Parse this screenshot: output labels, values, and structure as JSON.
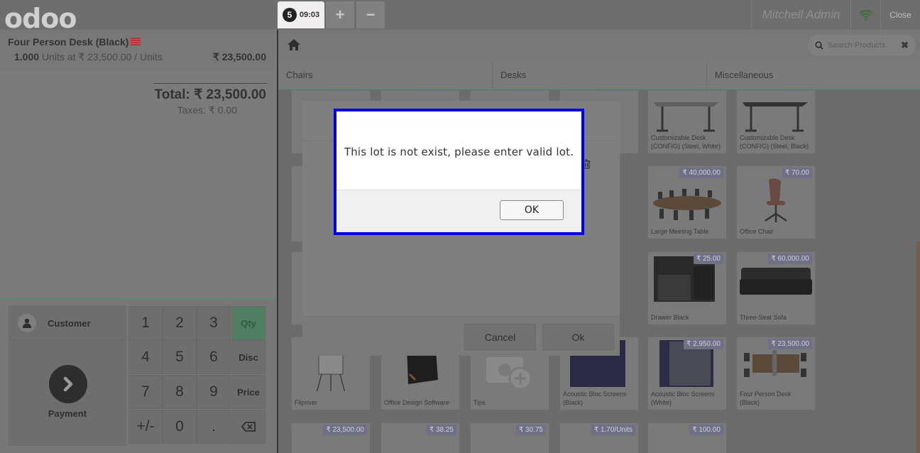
{
  "topbar": {
    "logo": "odoo",
    "order": {
      "number": "5",
      "time": "09:03"
    },
    "add_label": "+",
    "remove_label": "−",
    "user": "Mitchell Admin",
    "close_label": "Close"
  },
  "order": {
    "line": {
      "name": "Four Person Desk (Black)",
      "quantity": "1.000",
      "unit_text": "Units at ₹ 23,500.00 / Units",
      "price": "₹ 23,500.00"
    },
    "total": "Total: ₹ 23,500.00",
    "taxes": "Taxes: ₹ 0.00"
  },
  "actionpad": {
    "customer_label": "Customer",
    "payment_label": "Payment"
  },
  "numpad": {
    "keys": [
      "1",
      "2",
      "3",
      "4",
      "5",
      "6",
      "7",
      "8",
      "9",
      "+/-",
      "0",
      "."
    ],
    "modes": [
      "Qty",
      "Disc",
      "Price"
    ],
    "selected_mode": "Qty"
  },
  "products_header": {
    "search_placeholder": "Search Products",
    "categories": [
      "Chairs",
      "Desks",
      "Miscellaneous"
    ]
  },
  "products": [
    {
      "name": "Customizable Desk (CONFIG) (Steel, White)",
      "price": ""
    },
    {
      "name": "Customizable Desk (CONFIG) (Steel, Black)",
      "price": ""
    },
    {
      "name": "Large Meeting Table",
      "price": "₹ 40,000.00"
    },
    {
      "name": "Office Chair",
      "price": "₹ 70.00"
    },
    {
      "name": "Drawer Black",
      "price": "₹ 25.00"
    },
    {
      "name": "Three-Seat Sofa",
      "price": "₹ 60,000.00"
    },
    {
      "name": "Flipover",
      "price": ""
    },
    {
      "name": "Office Design Software",
      "price": ""
    },
    {
      "name": "Tips",
      "price": ""
    },
    {
      "name": "Acoustic Bloc Screens (Black)",
      "price": ""
    },
    {
      "name": "Acoustic Bloc Screens (White)",
      "price": "₹ 2,950.00"
    },
    {
      "name": "Four Person Desk (Black)",
      "price": "₹ 23,500.00"
    },
    {
      "name": "",
      "price": "₹ 23,500.00"
    },
    {
      "name": "",
      "price": "₹ 38.25"
    },
    {
      "name": "",
      "price": "₹ 30.75"
    },
    {
      "name": "",
      "price": "₹ 1.70/Units"
    },
    {
      "name": "",
      "price": "₹ 100.00"
    }
  ],
  "wizard": {
    "cancel_label": "Cancel",
    "ok_label": "Ok"
  },
  "alert": {
    "message": "This lot is not exist, please enter valid lot.",
    "ok_label": "OK"
  },
  "colors": {
    "alert_border": "#0000e0",
    "selected_mode": "#4f7e62",
    "price_tag": "#6f6f85"
  }
}
